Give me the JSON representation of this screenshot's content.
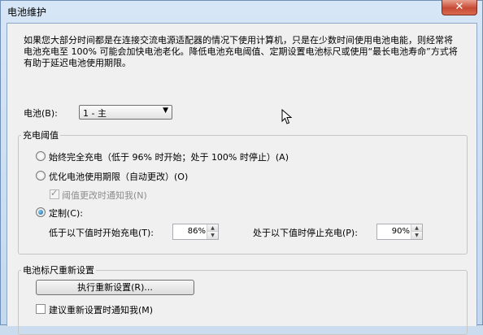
{
  "window": {
    "title": "电池维护",
    "close_glyph": "✕"
  },
  "description": "如果您大部分时间都是在连接交流电源适配器的情况下使用计算机，只是在少数时间使用电池电能，则经常将电池充电至 100% 可能会加快电池老化。降低电池充电阈值、定期设置电池标尺或使用“最长电池寿命”方式将有助于延迟电池使用期限。",
  "battery": {
    "label": "电池(B):",
    "selected": "1 - 主"
  },
  "threshold_group": {
    "title": "充电阈值",
    "options": [
      {
        "label": "始终完全充电（低于 96% 时开始；处于 100% 时停止）(A)",
        "selected": false
      },
      {
        "label": "优化电池使用期限（自动更改）(O)",
        "selected": false
      },
      {
        "label": "定制(C):",
        "selected": true
      }
    ],
    "notify": {
      "label": "阈值更改时通知我(N)",
      "checked": true,
      "disabled": true
    },
    "start": {
      "label": "低于以下值时开始充电(T):",
      "value": "86%"
    },
    "stop": {
      "label": "处于以下值时停止充电(P):",
      "value": "90%"
    }
  },
  "gauge_group": {
    "title": "电池标尺重新设置",
    "button_label": "执行重新设置(R)...",
    "suggest": {
      "label": "建议重新设置时通知我(M)",
      "checked": false
    }
  }
}
